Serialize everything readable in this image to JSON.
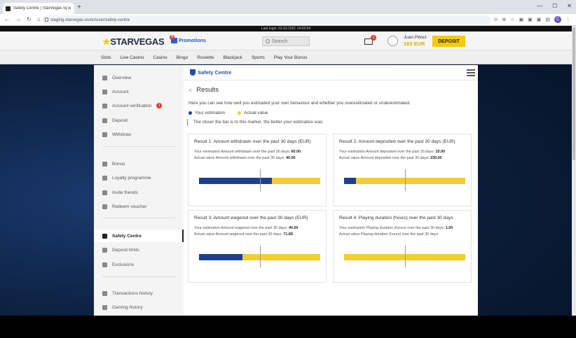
{
  "browser": {
    "tab_title": "Safety Centre | StarVegas Spain",
    "url": "staging.starvegas.es/en/user/safety-centre"
  },
  "site": {
    "last_login": "Last login: 03.03.2021 14:03:54",
    "logo": "STARVEGAS",
    "promotions_label": "Promotions",
    "promotions_badge": "3",
    "search_placeholder": "Search",
    "mail_badge": "1",
    "user_name": "Juan Pérez",
    "user_balance": "163 EUR",
    "deposit_label": "DEPOSIT",
    "menu": [
      "Slots",
      "Live Casino",
      "Casino",
      "Bingo",
      "Roulette",
      "Blackjack",
      "Sports",
      "Play Your Bonus"
    ]
  },
  "sidebar": {
    "items": [
      {
        "label": "Overview",
        "icon": "home-icon"
      },
      {
        "label": "Account",
        "icon": "user-icon"
      },
      {
        "label": "Account verification",
        "icon": "id-card-icon",
        "badge": "1"
      },
      {
        "label": "Deposit",
        "icon": "wallet-icon"
      },
      {
        "label": "Withdraw",
        "icon": "bank-icon"
      },
      {
        "label": "Bonus",
        "icon": "diamond-icon"
      },
      {
        "label": "Loyalty programme",
        "icon": "ticket-icon"
      },
      {
        "label": "Invite friends",
        "icon": "users-icon"
      },
      {
        "label": "Redeem voucher",
        "icon": "gift-icon"
      },
      {
        "label": "Safety Centre",
        "icon": "shield-icon",
        "active": true
      },
      {
        "label": "Deposit limits",
        "icon": "limit-icon"
      },
      {
        "label": "Exclusions",
        "icon": "block-icon"
      },
      {
        "label": "Transactions history",
        "icon": "history-icon"
      },
      {
        "label": "Gaming history",
        "icon": "gamepad-icon"
      }
    ]
  },
  "main": {
    "header_title": "Safety Centre",
    "results_title": "Results",
    "intro": "Here you can see how well you estimated your own behaviour and whether you overestimated or underestimated.",
    "legend_estimation": "Your estimation",
    "legend_actual": "Actual value",
    "hint": "The closer the bar is to this marker, the better your estimation was.",
    "colors": {
      "estimation": "#1d3f8f",
      "actual": "#f5cc32"
    },
    "cards": [
      {
        "title": "Result 1: Amount withdrawn over the past 30 days (EUR)",
        "est_label": "Your estimation Amount withdrawn over the past 30 days:",
        "est_value": "60.00",
        "act_label": "Actual value Amount withdrawn over the past 30 days:",
        "act_value": "40.00",
        "estimation_fraction": 0.6,
        "marker_fraction": 0.5
      },
      {
        "title": "Result 2: Amount deposited over the past 30 days (EUR)",
        "est_label": "Your estimation Amount deposited over the past 30 days:",
        "est_value": "25.00",
        "act_label": "Actual value Amount deposited over the past 30 days:",
        "act_value": "230.00",
        "estimation_fraction": 0.1,
        "marker_fraction": 0.5
      },
      {
        "title": "Result 3: Amount wagered over the past 30 days (EUR)",
        "est_label": "Your estimation Amount wagered over the past 30 days:",
        "est_value": "40.00",
        "act_label": "Actual value Amount wagered over the past 30 days:",
        "act_value": "71.89",
        "estimation_fraction": 0.36,
        "marker_fraction": 0.5
      },
      {
        "title": "Result 4: Playing duration (hours) over the past 30 days",
        "est_label": "Your estimation Playing duration (hours) over the past 30 days:",
        "est_value": "1.00",
        "act_label": "Actual value Playing duration (hours) over the past 30 days:",
        "act_value": "",
        "estimation_fraction": 0.0,
        "marker_fraction": 0.5
      }
    ]
  }
}
